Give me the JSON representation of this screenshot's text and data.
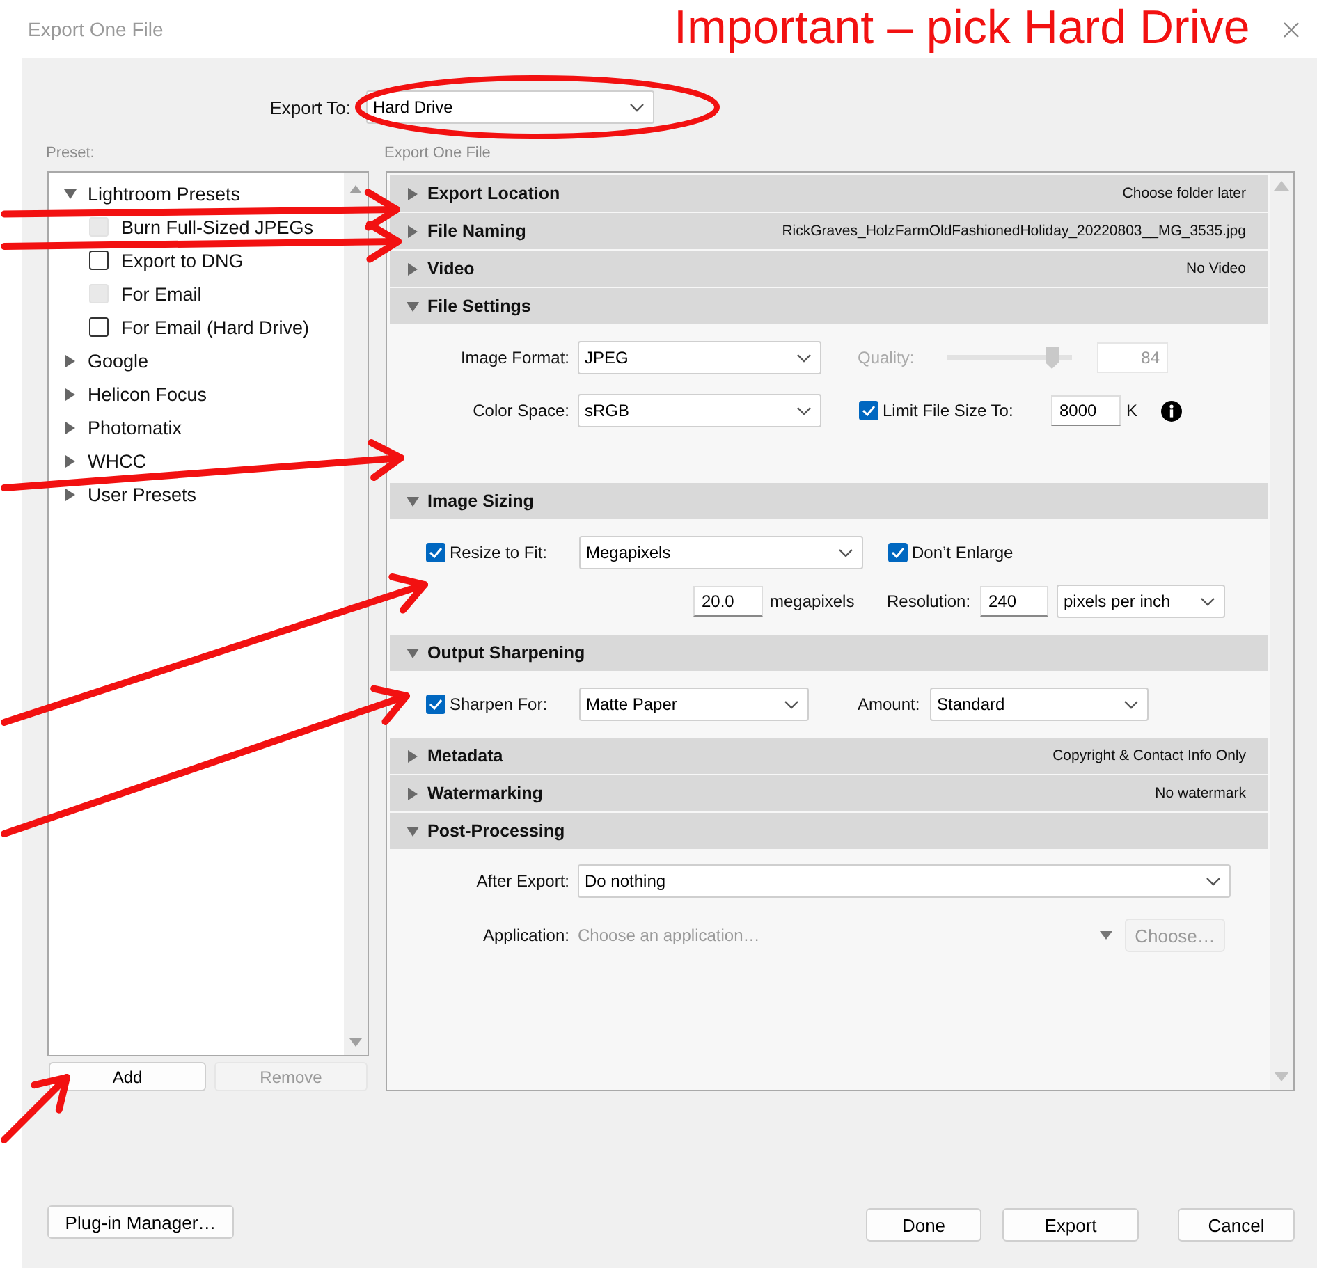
{
  "window": {
    "title": "Export One File"
  },
  "annotation": {
    "text": "Important – pick Hard Drive"
  },
  "export_to": {
    "label": "Export To:",
    "value": "Hard Drive"
  },
  "presets": {
    "label": "Preset:",
    "tree": [
      {
        "label": "Lightroom Presets",
        "expanded": true,
        "children": [
          {
            "label": "Burn Full-Sized JPEGs",
            "checked": false,
            "disabled": true
          },
          {
            "label": "Export to DNG",
            "checked": false,
            "disabled": false
          },
          {
            "label": "For Email",
            "checked": false,
            "disabled": true
          },
          {
            "label": "For Email (Hard Drive)",
            "checked": false,
            "disabled": false
          }
        ]
      },
      {
        "label": "Google",
        "expanded": false
      },
      {
        "label": "Helicon Focus",
        "expanded": false
      },
      {
        "label": "Photomatix",
        "expanded": false
      },
      {
        "label": "WHCC",
        "expanded": false
      },
      {
        "label": "User Presets",
        "expanded": false
      }
    ],
    "buttons": [
      {
        "label": "Add",
        "disabled": false
      },
      {
        "label": "Remove",
        "disabled": true
      }
    ]
  },
  "settings": {
    "label": "Export One File",
    "sections": [
      {
        "kind": "summary",
        "title": "Export Location",
        "expanded": false,
        "summary": "Choose folder later"
      },
      {
        "kind": "summary",
        "title": "File Naming",
        "expanded": false,
        "summary": "RickGraves_HolzFarmOldFashionedHoliday_20220803__MG_3535.jpg"
      },
      {
        "kind": "summary",
        "title": "Video",
        "expanded": false,
        "summary": "No Video"
      },
      {
        "kind": "file_settings",
        "title": "File Settings",
        "expanded": true,
        "image_format": {
          "label": "Image Format:",
          "value": "JPEG"
        },
        "quality": {
          "label": "Quality:",
          "level": 0.84,
          "value": "84",
          "disabled": true
        },
        "color_space": {
          "label": "Color Space:",
          "value": "sRGB"
        },
        "limit_file_size": {
          "label": "Limit File Size To:",
          "checked": true,
          "value": "8000",
          "unit": "K"
        }
      },
      {
        "kind": "image_sizing",
        "title": "Image Sizing",
        "expanded": true,
        "resize_to_fit": {
          "label": "Resize to Fit:",
          "checked": true,
          "value": "Megapixels"
        },
        "dont_enlarge": {
          "label": "Don’t Enlarge",
          "checked": true
        },
        "megapixels": {
          "value": "20.0",
          "unit": "megapixels"
        },
        "resolution": {
          "label": "Resolution:",
          "value": "240",
          "unit": "pixels per inch"
        }
      },
      {
        "kind": "output_sharpening",
        "title": "Output Sharpening",
        "expanded": true,
        "sharpen_for": {
          "label": "Sharpen For:",
          "checked": true,
          "value": "Matte Paper"
        },
        "amount": {
          "label": "Amount:",
          "value": "Standard"
        }
      },
      {
        "kind": "summary",
        "title": "Metadata",
        "expanded": false,
        "summary": "Copyright & Contact Info Only"
      },
      {
        "kind": "summary",
        "title": "Watermarking",
        "expanded": false,
        "summary": "No watermark"
      },
      {
        "kind": "post_processing",
        "title": "Post-Processing",
        "expanded": true,
        "after_export": {
          "label": "After Export:",
          "value": "Do nothing"
        },
        "application": {
          "label": "Application:",
          "placeholder": "Choose an application…",
          "button": "Choose…",
          "button_disabled": true
        }
      }
    ]
  },
  "footer": {
    "plugin_manager": "Plug-in Manager…",
    "buttons": [
      "Done",
      "Export",
      "Cancel"
    ]
  }
}
